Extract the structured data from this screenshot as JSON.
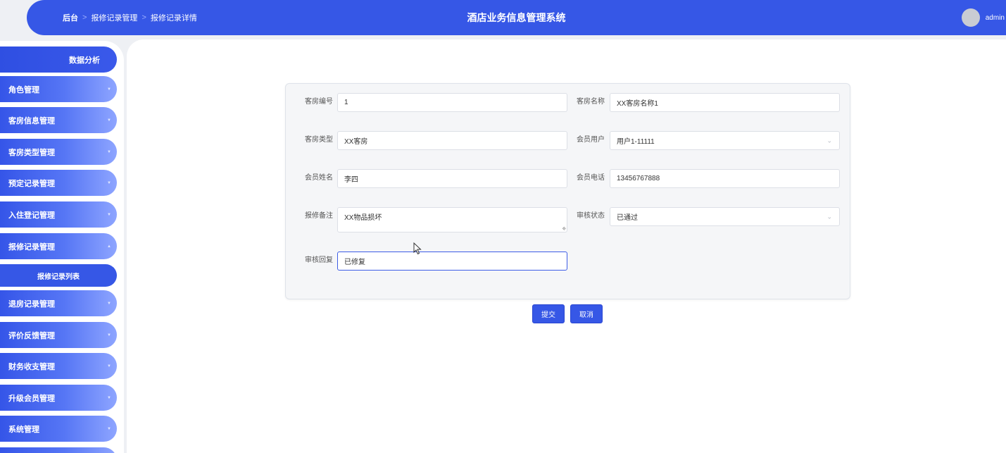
{
  "header": {
    "breadcrumb": [
      "后台",
      "报修记录管理",
      "报修记录详情"
    ],
    "title": "酒店业务信息管理系统",
    "user": "admin"
  },
  "sidebar": {
    "items": [
      {
        "label": "数据分析"
      },
      {
        "label": "角色管理"
      },
      {
        "label": "客房信息管理"
      },
      {
        "label": "客房类型管理"
      },
      {
        "label": "预定记录管理"
      },
      {
        "label": "入住登记管理"
      },
      {
        "label": "报修记录管理"
      },
      {
        "label": "报修记录列表"
      },
      {
        "label": "退房记录管理"
      },
      {
        "label": "评价反馈管理"
      },
      {
        "label": "财务收支管理"
      },
      {
        "label": "升级会员管理"
      },
      {
        "label": "系统管理"
      }
    ]
  },
  "form": {
    "room_no": {
      "label": "客房编号",
      "value": "1"
    },
    "room_name": {
      "label": "客房名称",
      "value": "XX客房名称1"
    },
    "room_type": {
      "label": "客房类型",
      "value": "XX客房"
    },
    "member_user": {
      "label": "会员用户",
      "value": "用户1-11111"
    },
    "member_name": {
      "label": "会员姓名",
      "value": "李四"
    },
    "member_phone": {
      "label": "会员电话",
      "value": "13456767888"
    },
    "repair_note": {
      "label": "报修备注",
      "value": "XX物品损坏"
    },
    "audit_status": {
      "label": "审核状态",
      "value": "已通过"
    },
    "audit_reply": {
      "label": "审核回复",
      "value": "已修复"
    }
  },
  "buttons": {
    "submit": "提交",
    "cancel": "取消"
  },
  "icons": {
    "chevron": "chevron-down-icon",
    "dropdown": "dropdown-arrow-icon",
    "cursor": "mouse-pointer-icon"
  }
}
